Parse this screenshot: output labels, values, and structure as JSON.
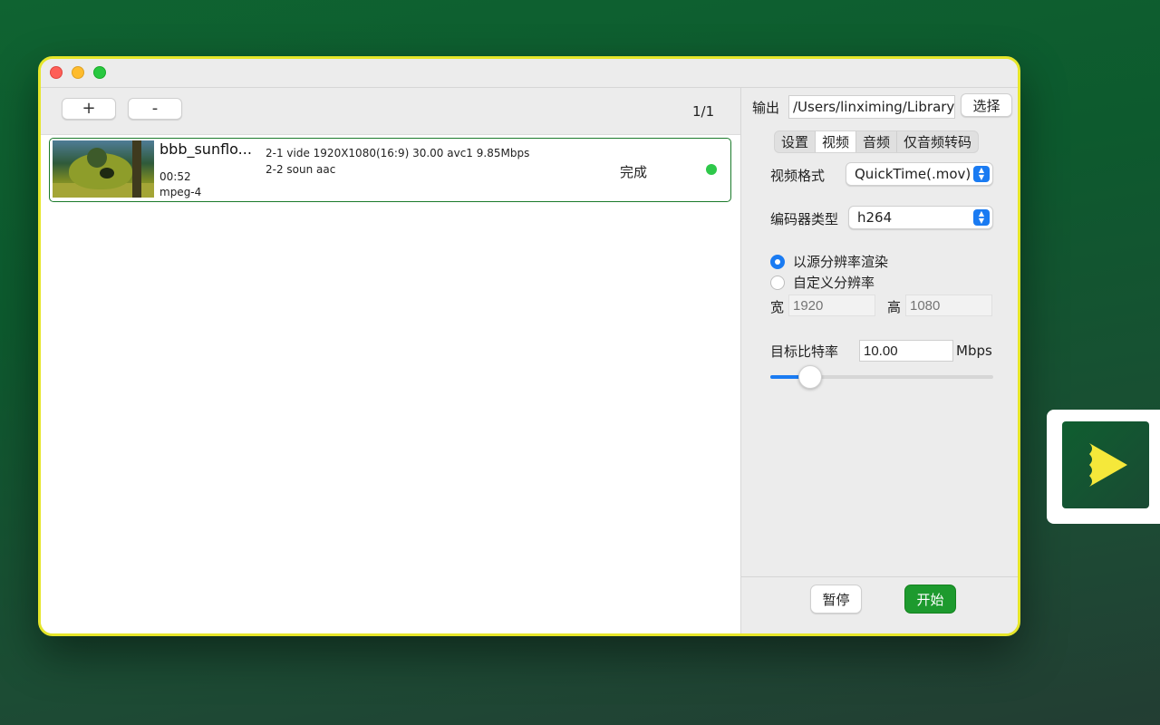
{
  "window": {
    "traffic_lights": [
      "close",
      "minimize",
      "zoom"
    ]
  },
  "toolbar": {
    "add_label": "+",
    "remove_label": "-",
    "page_count": "1/1"
  },
  "files": [
    {
      "name": "bbb_sunflo...",
      "duration": "00:52",
      "format": "mpeg-4",
      "streams": [
        "2-1 vide 1920X1080(16:9) 30.00 avc1 9.85Mbps",
        "2-2 soun aac"
      ],
      "status": "完成",
      "status_color": "#2ec84a"
    }
  ],
  "output": {
    "label": "输出",
    "path": "/Users/linximing/Library/C",
    "choose_label": "选择"
  },
  "tabs": [
    {
      "label": "设置",
      "active": false
    },
    {
      "label": "视频",
      "active": true
    },
    {
      "label": "音频",
      "active": false
    },
    {
      "label": "仅音频转码",
      "active": false
    }
  ],
  "video": {
    "format_label": "视频格式",
    "format_value": "QuickTime(.mov)",
    "encoder_label": "编码器类型",
    "encoder_value": "h264",
    "resolution_options": [
      {
        "label": "以源分辨率渲染",
        "checked": true
      },
      {
        "label": "自定义分辨率",
        "checked": false
      }
    ],
    "width_label": "宽",
    "width_placeholder": "1920",
    "height_label": "高",
    "height_placeholder": "1080",
    "bitrate_label": "目标比特率",
    "bitrate_value": "10.00",
    "bitrate_unit": "Mbps",
    "bitrate_slider_fraction": 0.14
  },
  "actions": {
    "pause_label": "暂停",
    "start_label": "开始"
  },
  "colors": {
    "accent": "#1a7bf2",
    "start_button": "#1d9a2e",
    "window_border": "#e6e62a"
  },
  "app_icon": {
    "name": "play-icon"
  }
}
